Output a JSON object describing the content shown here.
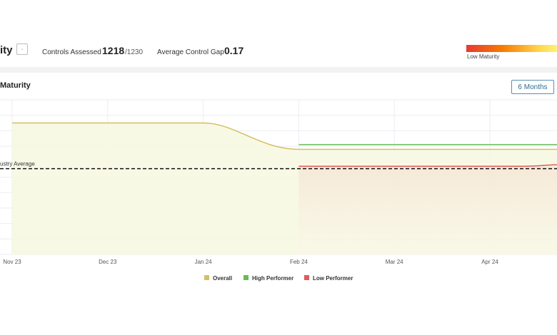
{
  "header": {
    "title": "ity",
    "controls_assessed_label": "Controls Assessed",
    "controls_assessed_value": "1218",
    "controls_assessed_total": "/1230",
    "avg_gap_label": "Average Control Gap",
    "avg_gap_value": "0.17",
    "maturity_legend_label": "Low Maturity"
  },
  "chart": {
    "title": "Maturity",
    "range_button": "6 Months",
    "benchmark_label": "ustry Average"
  },
  "chart_data": {
    "type": "line",
    "title": "Maturity",
    "x_ticks": [
      "Nov 23",
      "Dec 23",
      "Jan 24",
      "Feb 24",
      "Mar 24",
      "Apr 24"
    ],
    "series": [
      {
        "name": "Overall",
        "color": "#d4c063",
        "points": [
          [
            "Nov 23",
            0.85
          ],
          [
            "Dec 23",
            0.85
          ],
          [
            "Jan 24",
            0.85
          ],
          [
            "Feb 24",
            0.68
          ],
          [
            "Mar 24",
            0.68
          ],
          [
            "Apr 24",
            0.68
          ],
          [
            "May 24",
            0.68
          ]
        ]
      },
      {
        "name": "High Performer",
        "color": "#66bb55",
        "points": [
          [
            "Feb 24",
            0.71
          ],
          [
            "Mar 24",
            0.71
          ],
          [
            "Apr 24",
            0.71
          ],
          [
            "May 24",
            0.71
          ]
        ]
      },
      {
        "name": "Low Performer",
        "color": "#e05a5a",
        "points": [
          [
            "Feb 24",
            0.57
          ],
          [
            "Mar 24",
            0.57
          ],
          [
            "Apr 24",
            0.57
          ],
          [
            "May 24",
            0.58
          ]
        ]
      }
    ],
    "benchmark": {
      "name": "Industry Average",
      "value": 0.555,
      "style": "dashed"
    },
    "y_range": [
      0,
      1
    ],
    "grid": true,
    "legend_position": "bottom-center"
  }
}
